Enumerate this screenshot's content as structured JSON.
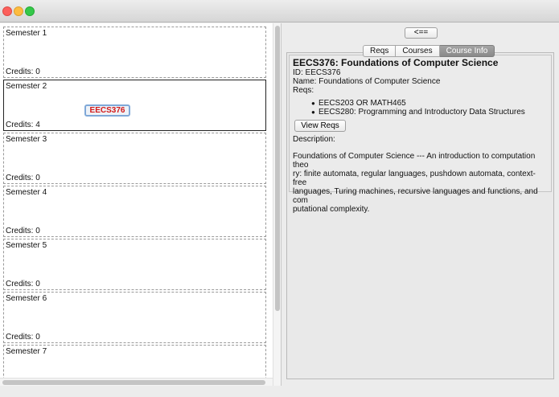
{
  "window": {
    "buttons": [
      "close",
      "minimize",
      "zoom"
    ]
  },
  "semesters": [
    {
      "title": "Semester 1",
      "credits": "Credits: 0",
      "courses": []
    },
    {
      "title": "Semester 2",
      "credits": "Credits: 4",
      "courses": [
        "EECS376"
      ],
      "selected": true
    },
    {
      "title": "Semester 3",
      "credits": "Credits: 0",
      "courses": []
    },
    {
      "title": "Semester 4",
      "credits": "Credits: 0",
      "courses": []
    },
    {
      "title": "Semester 5",
      "credits": "Credits: 0",
      "courses": []
    },
    {
      "title": "Semester 6",
      "credits": "Credits: 0",
      "courses": []
    },
    {
      "title": "Semester 7",
      "credits": "",
      "courses": []
    }
  ],
  "right": {
    "back_label": "<==",
    "tabs": [
      {
        "label": "Reqs",
        "active": false
      },
      {
        "label": "Courses",
        "active": false
      },
      {
        "label": "Course Info",
        "active": true
      }
    ]
  },
  "course_info": {
    "title": "EECS376: Foundations of Computer Science",
    "id_line": "ID: EECS376",
    "name_line": "Name: Foundations of Computer Science",
    "reqs_label": "Reqs:",
    "reqs": [
      "EECS203 OR MATH465",
      "EECS280: Programming and Introductory Data Structures"
    ],
    "view_reqs_label": "View Reqs",
    "description_label": "Description:",
    "description_lines": [
      "Foundations of Computer Science --- An introduction to computation theo",
      "ry: finite automata, regular languages, pushdown automata, context-free",
      "languages, Turing machines, recursive languages and functions, and com",
      "putational complexity."
    ]
  },
  "colors": {
    "course_chip_text": "#d21919",
    "course_chip_border": "#7fa8d8",
    "active_tab": "#8a8a8a"
  }
}
